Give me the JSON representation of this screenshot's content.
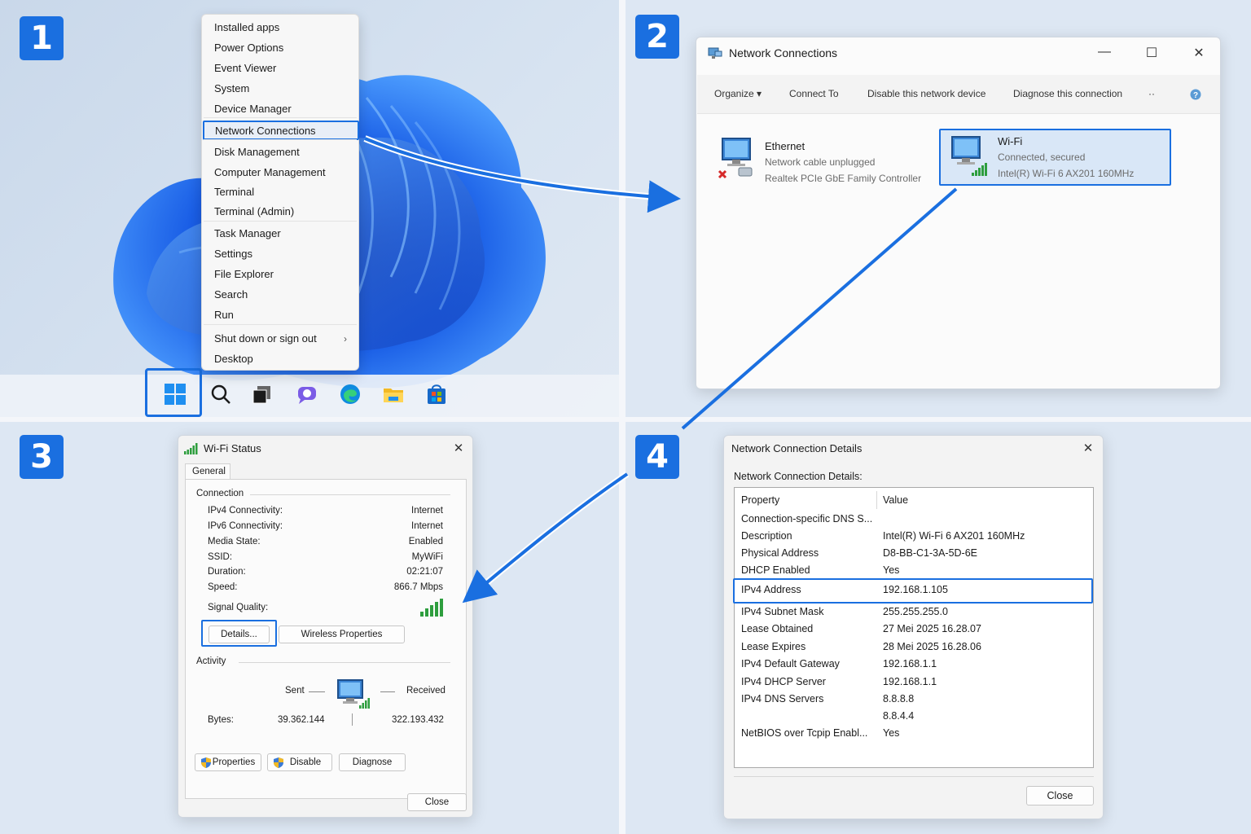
{
  "steps": [
    "1",
    "2",
    "3",
    "4"
  ],
  "context_menu": {
    "items": [
      {
        "label": "Installed apps",
        "highlighted": false
      },
      {
        "label": "Power Options",
        "highlighted": false
      },
      {
        "label": "Event Viewer",
        "highlighted": false
      },
      {
        "label": "System",
        "highlighted": false
      },
      {
        "label": "Device Manager",
        "highlighted": false
      },
      {
        "label": "Network Connections",
        "highlighted": true
      },
      {
        "label": "Disk Management",
        "highlighted": false
      },
      {
        "label": "Computer Management",
        "highlighted": false
      },
      {
        "label": "Terminal",
        "highlighted": false
      },
      {
        "label": "Terminal (Admin)",
        "highlighted": false
      },
      {
        "label": "Task Manager",
        "highlighted": false
      },
      {
        "label": "Settings",
        "highlighted": false
      },
      {
        "label": "File Explorer",
        "highlighted": false
      },
      {
        "label": "Search",
        "highlighted": false
      },
      {
        "label": "Run",
        "highlighted": false
      },
      {
        "label": "Shut down or sign out",
        "highlighted": false
      },
      {
        "label": "Desktop",
        "highlighted": false
      }
    ],
    "chevron": "›"
  },
  "taskbar": {
    "icons": [
      "start-icon",
      "search-icon",
      "task-view-icon",
      "chat-icon",
      "edge-icon",
      "file-explorer-icon",
      "store-icon"
    ]
  },
  "network_connections": {
    "title": "Network Connections",
    "controls": {
      "minimize": "—",
      "maximize": "☐",
      "close": "✕"
    },
    "toolbar": {
      "organize": "Organize ▾",
      "connect_to": "Connect To",
      "disable": "Disable this network device",
      "diagnose": "Diagnose this connection",
      "more": "··"
    },
    "adapters": [
      {
        "name": "Ethernet",
        "status": "Network cable unplugged",
        "device": "Realtek PCIe GbE Family Controller",
        "selected": false
      },
      {
        "name": "Wi-Fi",
        "status": "Connected, secured",
        "device": "Intel(R) Wi-Fi 6 AX201 160MHz",
        "selected": true
      }
    ]
  },
  "wifi_status": {
    "title": "Wi-Fi Status",
    "close": "✕",
    "tab": "General",
    "connection_group": "Connection",
    "rows": [
      {
        "label": "IPv4 Connectivity:",
        "value": "Internet"
      },
      {
        "label": "IPv6 Connectivity:",
        "value": "Internet"
      },
      {
        "label": "Media State:",
        "value": "Enabled"
      },
      {
        "label": "SSID:",
        "value": "MyWiFi"
      },
      {
        "label": "Duration:",
        "value": "02:21:07"
      },
      {
        "label": "Speed:",
        "value": "866.7 Mbps"
      }
    ],
    "signal_label": "Signal Quality:",
    "signal_bars": 5,
    "details_button": "Details...",
    "wireless_button": "Wireless Properties",
    "activity_group": "Activity",
    "sent_label": "Sent",
    "received_label": "Received",
    "bytes_label": "Bytes:",
    "bytes_sent": "39.362.144",
    "bytes_received": "322.193.432",
    "properties_button": "Properties",
    "disable_button": "Disable",
    "diagnose_button": "Diagnose",
    "close_button": "Close"
  },
  "details": {
    "title": "Network Connection Details",
    "close": "✕",
    "heading": "Network Connection Details:",
    "col_property": "Property",
    "col_value": "Value",
    "rows": [
      {
        "property": "Connection-specific DNS S...",
        "value": ""
      },
      {
        "property": "Description",
        "value": "Intel(R) Wi-Fi 6 AX201 160MHz"
      },
      {
        "property": "Physical Address",
        "value": "D8-BB-C1-3A-5D-6E"
      },
      {
        "property": "DHCP Enabled",
        "value": "Yes"
      },
      {
        "property": "IPv4 Address",
        "value": "192.168.1.105"
      },
      {
        "property": "IPv4 Subnet Mask",
        "value": "255.255.255.0"
      },
      {
        "property": "Lease Obtained",
        "value": "27 Mei 2025 16.28.07"
      },
      {
        "property": "Lease Expires",
        "value": "28 Mei 2025 16.28.06"
      },
      {
        "property": "IPv4 Default Gateway",
        "value": "192.168.1.1"
      },
      {
        "property": "IPv4 DHCP Server",
        "value": "192.168.1.1"
      },
      {
        "property": "IPv4 DNS Servers",
        "value": "8.8.8.8"
      },
      {
        "property": "",
        "value": "8.8.4.4"
      },
      {
        "property": "NetBIOS over Tcpip Enabl...",
        "value": "Yes"
      }
    ],
    "close_button": "Close"
  },
  "colors": {
    "accent": "#1a6fe0",
    "signal": "#2e9e3e",
    "error": "#d62a2a"
  }
}
